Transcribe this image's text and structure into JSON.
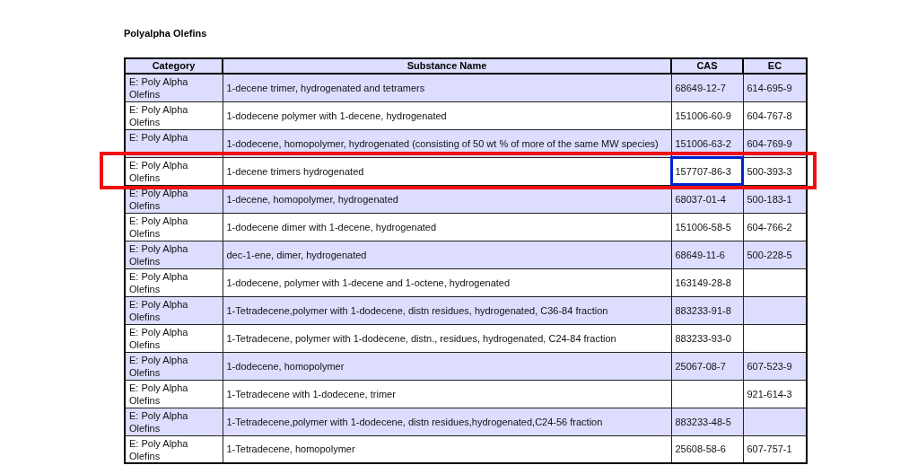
{
  "page": {
    "title": "Polyalpha Olefins"
  },
  "table": {
    "columns": [
      "Category",
      "Substance Name",
      "CAS",
      "EC"
    ],
    "rows": [
      {
        "category": "E: Poly Alpha Olefins",
        "substance": "1-decene trimer, hydrogenated and tetramers",
        "cas": "68649-12-7",
        "ec": "614-695-9",
        "shaded": true,
        "highlighted": false,
        "cas_outlined": false
      },
      {
        "category": "E: Poly Alpha Olefins",
        "substance": "1-dodecene polymer with 1-decene, hydrogenated",
        "cas": "151006-60-9",
        "ec": "604-767-8",
        "shaded": false,
        "highlighted": false,
        "cas_outlined": false
      },
      {
        "category": "E: Poly Alpha",
        "substance": "1-dodecene, homopolymer, hydrogenated (consisting of 50 wt % of more of the same MW species)",
        "cas": "151006-63-2",
        "ec": "604-769-9",
        "shaded": true,
        "highlighted": false,
        "cas_outlined": false
      },
      {
        "category": "E: Poly Alpha Olefins",
        "substance": "1-decene trimers hydrogenated",
        "cas": "157707-86-3",
        "ec": "500-393-3",
        "shaded": false,
        "highlighted": true,
        "cas_outlined": true
      },
      {
        "category": "E: Poly Alpha Olefins",
        "substance": "1-decene, homopolymer, hydrogenated",
        "cas": "68037-01-4",
        "ec": "500-183-1",
        "shaded": true,
        "highlighted": false,
        "cas_outlined": false
      },
      {
        "category": "E: Poly Alpha Olefins",
        "substance": "1-dodecene dimer with 1-decene, hydrogenated",
        "cas": "151006-58-5",
        "ec": "604-766-2",
        "shaded": false,
        "highlighted": false,
        "cas_outlined": false
      },
      {
        "category": "E: Poly Alpha Olefins",
        "substance": "dec-1-ene, dimer, hydrogenated",
        "cas": "68649-11-6",
        "ec": "500-228-5",
        "shaded": true,
        "highlighted": false,
        "cas_outlined": false
      },
      {
        "category": "E: Poly Alpha Olefins",
        "substance": "1-dodecene, polymer with 1-decene and 1-octene, hydrogenated",
        "cas": "163149-28-8",
        "ec": "",
        "shaded": false,
        "highlighted": false,
        "cas_outlined": false
      },
      {
        "category": "E: Poly Alpha Olefins",
        "substance": "1-Tetradecene,polymer with 1-dodecene, distn residues, hydrogenated, C36-84 fraction",
        "cas": "883233-91-8",
        "ec": "",
        "shaded": true,
        "highlighted": false,
        "cas_outlined": false
      },
      {
        "category": "E: Poly Alpha Olefins",
        "substance": "1-Tetradecene, polymer with 1-dodecene, distn., residues, hydrogenated, C24-84 fraction",
        "cas": "883233-93-0",
        "ec": "",
        "shaded": false,
        "highlighted": false,
        "cas_outlined": false
      },
      {
        "category": "E: Poly Alpha Olefins",
        "substance": "1-dodecene, homopolymer",
        "cas": "25067-08-7",
        "ec": "607-523-9",
        "shaded": true,
        "highlighted": false,
        "cas_outlined": false
      },
      {
        "category": "E: Poly Alpha Olefins",
        "substance": "1-Tetradecene with 1-dodecene, trimer",
        "cas": "",
        "ec": "921-614-3",
        "shaded": false,
        "highlighted": false,
        "cas_outlined": false
      },
      {
        "category": "E: Poly Alpha Olefins",
        "substance": "1-Tetradecene,polymer with 1-dodecene, distn residues,hydrogenated,C24-56 fraction",
        "cas": "883233-48-5",
        "ec": "",
        "shaded": true,
        "highlighted": false,
        "cas_outlined": false
      },
      {
        "category": "E: Poly Alpha Olefins",
        "substance": "1-Tetradecene, homopolymer",
        "cas": "25608-58-6",
        "ec": "607-757-1",
        "shaded": false,
        "highlighted": false,
        "cas_outlined": false
      }
    ]
  }
}
